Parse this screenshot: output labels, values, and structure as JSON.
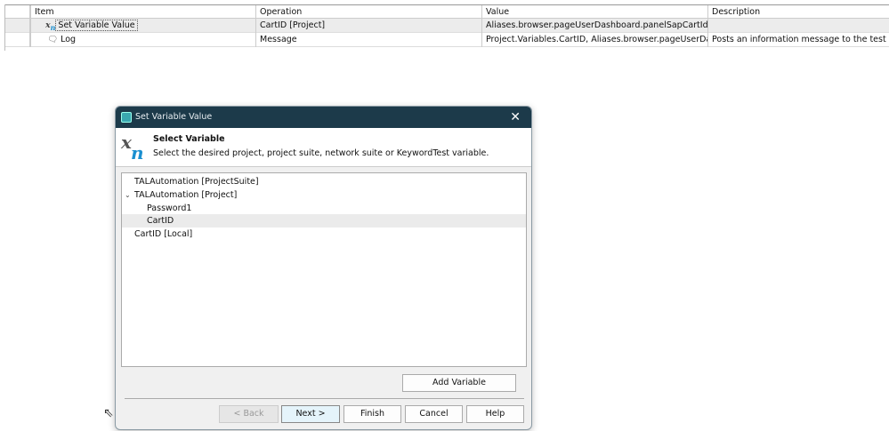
{
  "grid": {
    "columns": [
      "Item",
      "Operation",
      "Value",
      "Description"
    ],
    "rows": [
      {
        "item": "Set Variable Value",
        "icon": "variable-xn-icon",
        "operation": "CartID [Project]",
        "value": "Aliases.browser.pageUserDashboard.panelSapCartId",
        "description": ""
      },
      {
        "item": "Log",
        "icon": "log-message-icon",
        "operation": "Message",
        "value": "Project.Variables.CartID, Aliases.browser.pageUserDash",
        "description": "Posts an information message to the test log."
      }
    ]
  },
  "dialog": {
    "title": "Set Variable Value",
    "header_title": "Select Variable",
    "header_subtitle": "Select the desired project, project suite, network suite or KeywordTest variable.",
    "tree": [
      "TALAutomation [ProjectSuite]",
      "TALAutomation [Project]",
      "Password1",
      "CartID",
      "CartID [Local]"
    ],
    "add_variable": "Add Variable",
    "back": "< Back",
    "next": "Next >",
    "finish": "Finish",
    "cancel": "Cancel",
    "help": "Help"
  }
}
